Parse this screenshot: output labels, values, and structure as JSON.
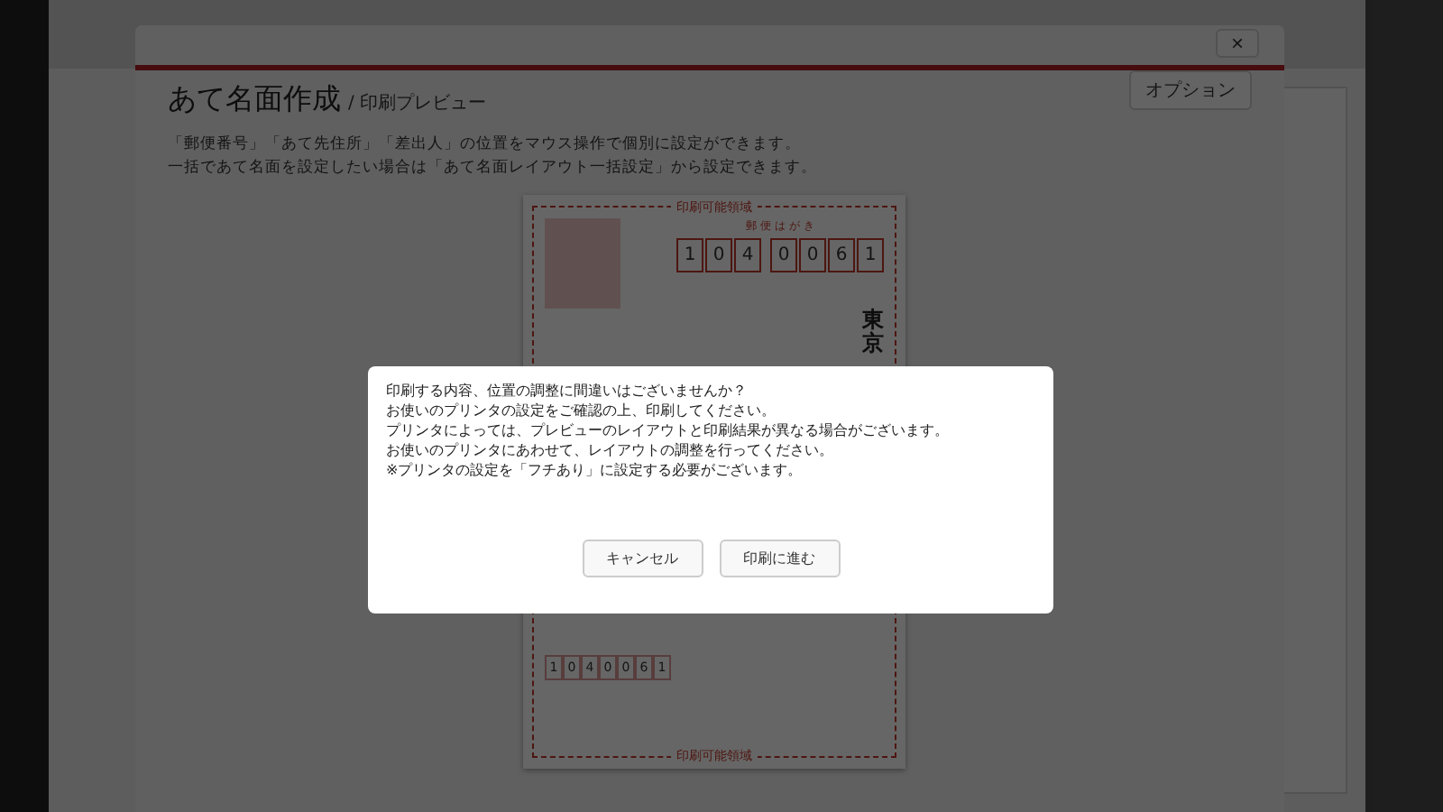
{
  "window": {
    "close": "×"
  },
  "panel": {
    "title": "あて名面作成",
    "subtitle": "/ 印刷プレビュー",
    "option_button": "オプション",
    "instructions": [
      "「郵便番号」「あて先住所」「差出人」の位置をマウス操作で個別に設定ができます。",
      "一括であて名面を設定したい場合は「あて名面レイアウト一括設定」から設定できます。"
    ]
  },
  "postcard": {
    "area_label_top": "印刷可能領域",
    "kana": "郵 便 は が き",
    "postal_digits": [
      "1",
      "0",
      "4",
      "0",
      "0",
      "6",
      "1"
    ],
    "address": "東京",
    "sender_postal_digits": [
      "1",
      "0",
      "4",
      "0",
      "0",
      "6",
      "1"
    ],
    "area_label_bottom": "印刷可能領域"
  },
  "dialog": {
    "lines": [
      "印刷する内容、位置の調整に間違いはございませんか？",
      "お使いのプリンタの設定をご確認の上、印刷してください。",
      "プリンタによっては、プレビューのレイアウトと印刷結果が異なる場合がございます。",
      "お使いのプリンタにあわせて、レイアウトの調整を行ってください。",
      "※プリンタの設定を「フチあり」に設定する必要がございます。"
    ],
    "buttons": [
      {
        "label": "キャンセル"
      },
      {
        "label": "印刷に進む"
      }
    ]
  }
}
